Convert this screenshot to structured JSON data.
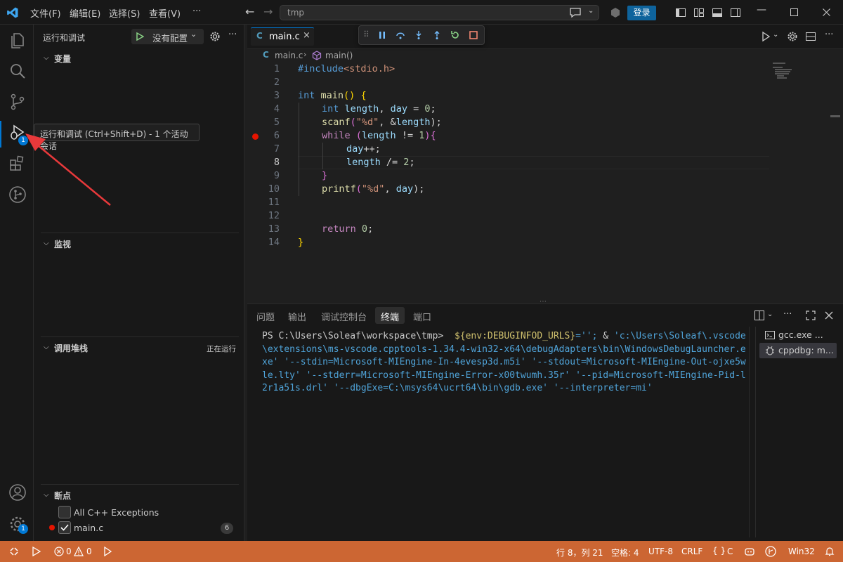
{
  "titlebar": {
    "menus": [
      "文件(F)",
      "编辑(E)",
      "选择(S)",
      "查看(V)"
    ],
    "more": "···",
    "search_text": "tmp",
    "login": "登录"
  },
  "activitybar": {
    "debug_badge": "1",
    "settings_badge": "1"
  },
  "tooltip": "运行和调试 (Ctrl+Shift+D) - 1 个活动会话",
  "sidebar": {
    "title": "运行和调试",
    "config_label": "没有配置",
    "variables": "变量",
    "watch": "监视",
    "callstack": "调用堆栈",
    "callstack_status": "正在运行",
    "breakpoints": "断点",
    "bp_items": [
      {
        "label": "All C++ Exceptions",
        "checked": false
      },
      {
        "label": "main.c",
        "checked": true,
        "count": "6"
      }
    ]
  },
  "editor": {
    "tab_label": "main.c",
    "tab_icon": "C",
    "breadcrumb_file": "main.c",
    "breadcrumb_symbol": "main()",
    "line_numbers": [
      "1",
      "2",
      "3",
      "4",
      "5",
      "6",
      "7",
      "8",
      "9",
      "10",
      "11",
      "12",
      "13",
      "14"
    ],
    "lines": {
      "l1a": "#include",
      "l1b": "<stdio.h>",
      "l3a": "int",
      "l3b": "main",
      "l3c": "()",
      "l3d": "{",
      "l4a": "int",
      "l4b": "length",
      "l4c": ", ",
      "l4d": "day",
      "l4e": " = ",
      "l4f": "0",
      "l4g": ";",
      "l5a": "scanf",
      "l5b": "(",
      "l5c": "\"%d\"",
      "l5d": ", &",
      "l5e": "length",
      "l5f": ");",
      "l6a": "while",
      "l6b": " (",
      "l6c": "length",
      "l6d": " != ",
      "l6e": "1",
      "l6f": "){",
      "l7a": "day",
      "l7b": "++;",
      "l8a": "length",
      "l8b": " /= ",
      "l8c": "2",
      "l8d": ";",
      "l9a": "}",
      "l10a": "printf",
      "l10b": "(",
      "l10c": "\"%d\"",
      "l10d": ", ",
      "l10e": "day",
      "l10f": ");",
      "l13a": "return",
      "l13b": "0",
      "l13c": ";",
      "l14a": "}"
    }
  },
  "panel": {
    "tabs": [
      "问题",
      "输出",
      "调试控制台",
      "终端",
      "端口"
    ],
    "active_tab": "终端",
    "terminal_prompt": "PS C:\\Users\\Soleaf\\workspace\\tmp>",
    "terminal_cmd1": "${env:DEBUGINFOD_URLS}",
    "terminal_cmd2": "='';",
    "terminal_cmd3": " & ",
    "terminal_cmd4": "'c:\\Users\\Soleaf\\.vscode\\extensions\\ms-vscode.cpptools-1.34.4-win32-x64\\debugAdapters\\bin\\WindowsDebugLauncher.exe' '--stdin=Microsoft-MIEngine-In-4evesp3d.m5i' '--stdout=Microsoft-MIEngine-Out-ojxe5wle.lty' '--stderr=Microsoft-MIEngine-Error-x00twumh.35r' '--pid=Microsoft-MIEngine-Pid-l2r1a51s.drl' '--dbgExe=C:\\msys64\\ucrt64\\bin\\gdb.exe' '--interpreter=mi'",
    "terminals": [
      "gcc.exe ...",
      "cppdbg: m..."
    ]
  },
  "statusbar": {
    "errors": "0",
    "warnings": "0",
    "position": "行 8，列 21",
    "spaces": "空格: 4",
    "encoding": "UTF-8",
    "eol": "CRLF",
    "language": "C",
    "platform": "Win32"
  },
  "colors": {
    "statusbar": "#cc6633",
    "accent": "#0078d4",
    "breakpoint": "#e51400"
  }
}
